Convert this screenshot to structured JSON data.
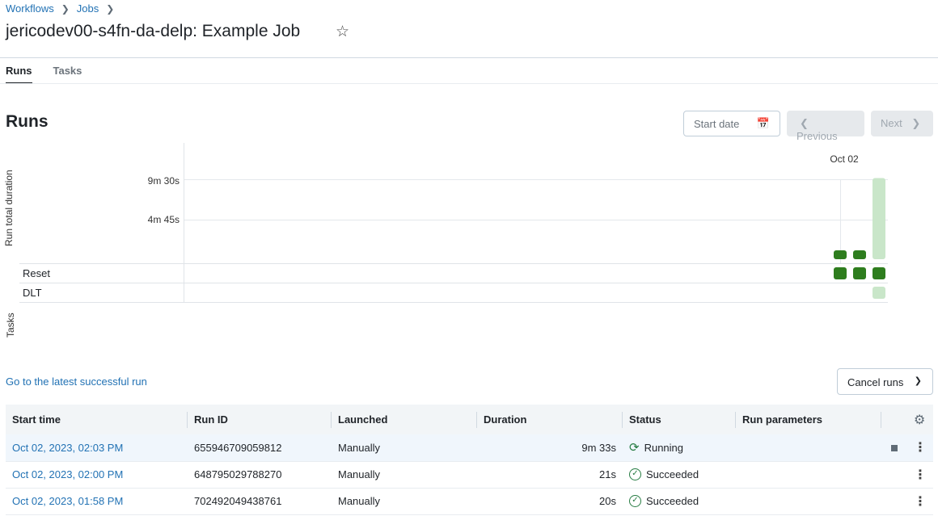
{
  "breadcrumb": {
    "items": [
      "Workflows",
      "Jobs"
    ]
  },
  "page": {
    "title": "jericodev00-s4fn-da-delp: Example Job"
  },
  "tabs": [
    {
      "label": "Runs",
      "active": true
    },
    {
      "label": "Tasks",
      "active": false
    }
  ],
  "runs_section": {
    "title": "Runs",
    "start_date_placeholder": "Start date",
    "previous_label": "Previous",
    "next_label": "Next"
  },
  "chart": {
    "date_label": "Oct 02",
    "ylabel_duration": "Run total duration",
    "ylabel_tasks": "Tasks",
    "y_ticks": [
      "9m 30s",
      "4m 45s"
    ],
    "task_rows": [
      "Reset",
      "DLT"
    ]
  },
  "chart_data": {
    "type": "bar",
    "categories": [
      "Oct 02, 2023, 01:58 PM",
      "Oct 02, 2023, 02:00 PM",
      "Oct 02, 2023, 02:03 PM"
    ],
    "values_seconds": [
      20,
      21,
      573
    ],
    "statuses": [
      "Succeeded",
      "Succeeded",
      "Running"
    ],
    "task_matrix": {
      "Reset": [
        "Succeeded",
        "Succeeded",
        "Succeeded"
      ],
      "DLT": [
        null,
        null,
        "Running"
      ]
    }
  },
  "go_latest_link": "Go to the latest successful run",
  "cancel_runs_label": "Cancel runs",
  "table": {
    "columns": [
      "Start time",
      "Run ID",
      "Launched",
      "Duration",
      "Status",
      "Run parameters"
    ],
    "rows": [
      {
        "start": "Oct 02, 2023, 02:03 PM",
        "run_id": "655946709059812",
        "launched": "Manually",
        "duration": "9m 33s",
        "status": "Running"
      },
      {
        "start": "Oct 02, 2023, 02:00 PM",
        "run_id": "648795029788270",
        "launched": "Manually",
        "duration": "21s",
        "status": "Succeeded"
      },
      {
        "start": "Oct 02, 2023, 01:58 PM",
        "run_id": "702492049438761",
        "launched": "Manually",
        "duration": "20s",
        "status": "Succeeded"
      }
    ]
  },
  "colors": {
    "link": "#2272b4",
    "success": "#2e7d1e",
    "running_light": "#c9e6c9"
  }
}
